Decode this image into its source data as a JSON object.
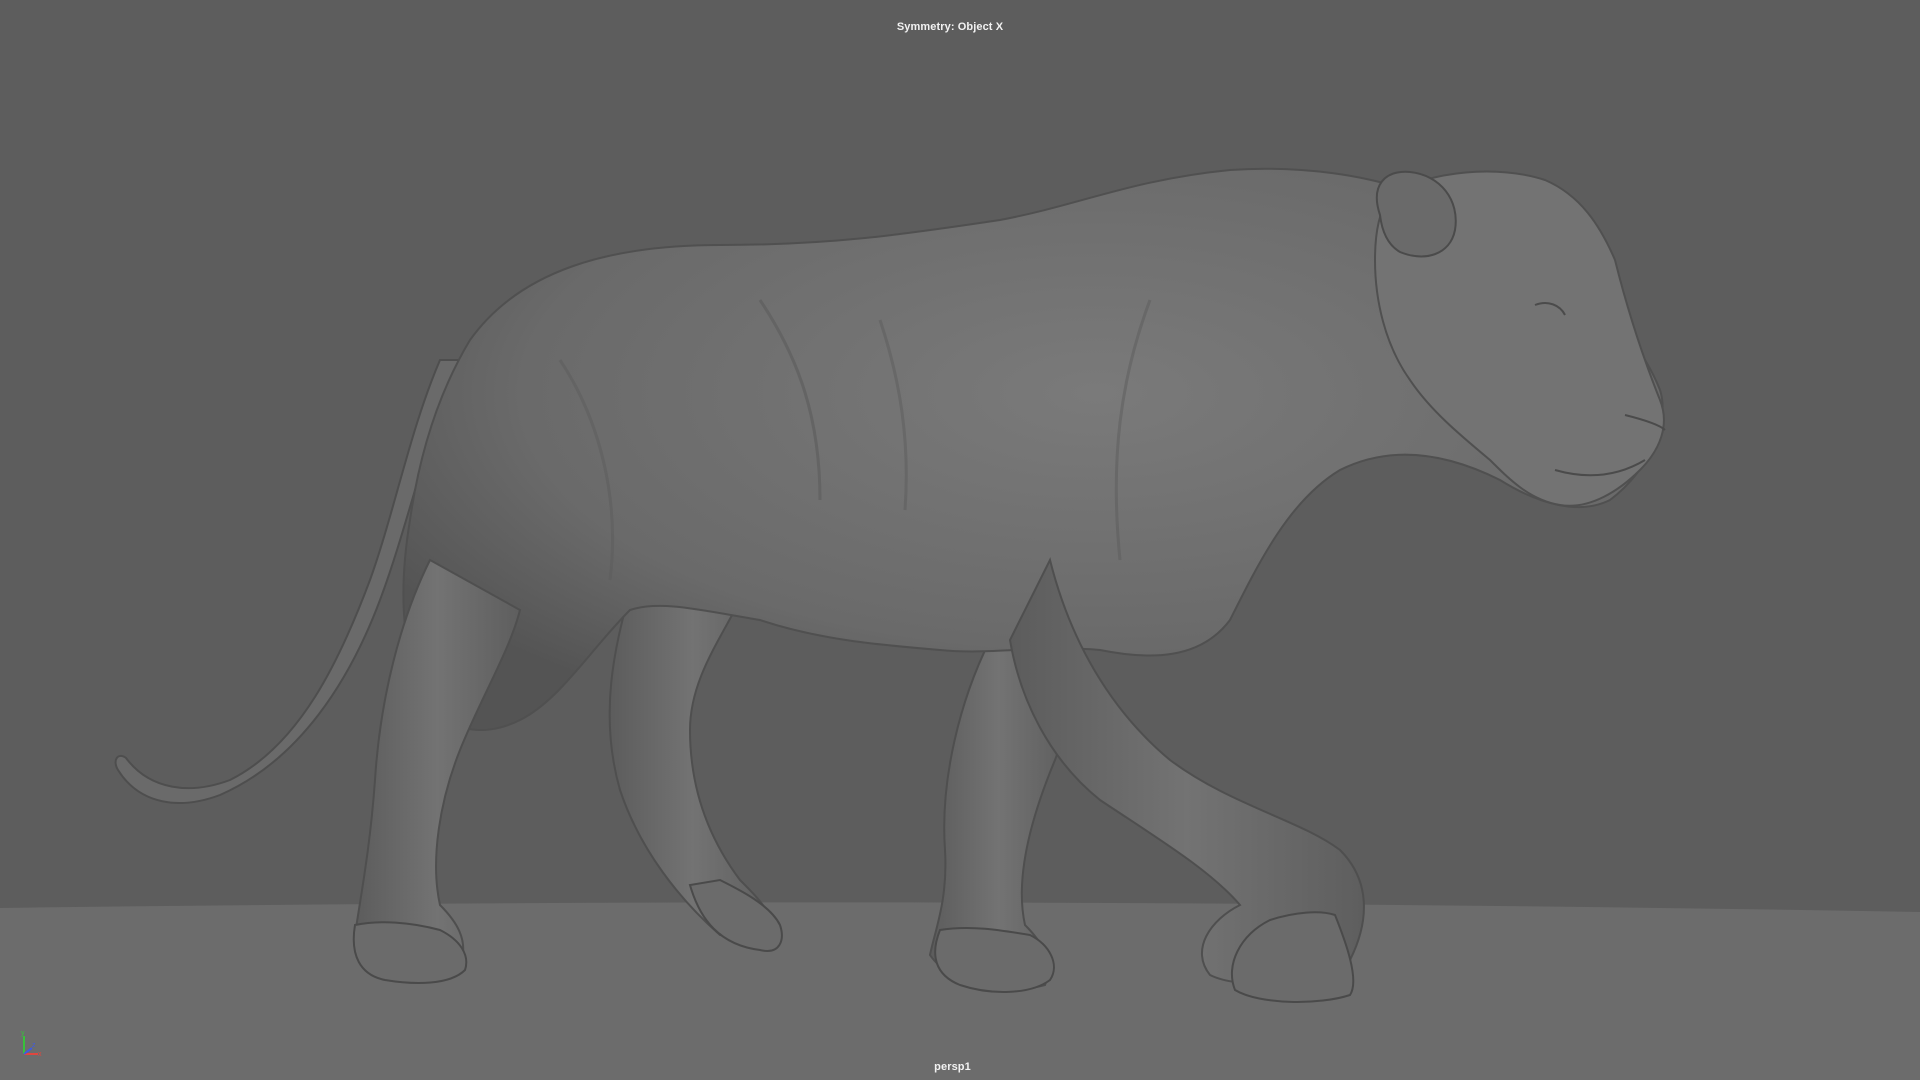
{
  "viewport": {
    "hud_top": "Symmetry: Object X",
    "camera_name": "persp1",
    "background_color": "#5d5d5d",
    "ground_color": "#6c6c6c",
    "model_color": "#6f6f6f",
    "model_subject": "big cat sculpt"
  },
  "axis_gizmo": {
    "x_color": "#e0463e",
    "y_color": "#37c23a",
    "z_color": "#3f5be0",
    "icon": "axis-gizmo-icon"
  }
}
